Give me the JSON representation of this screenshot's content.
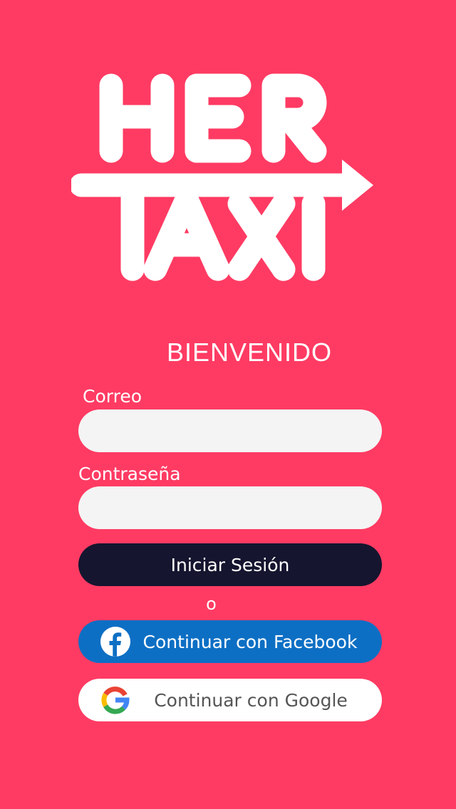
{
  "brand": {
    "logo_line1": "HER",
    "logo_line2": "TAXI"
  },
  "welcome": "BIENVENIDO",
  "form": {
    "email_label": "Correo",
    "email_value": "",
    "password_label": "Contraseña",
    "password_value": ""
  },
  "buttons": {
    "login": "Iniciar Sesión",
    "separator": "o",
    "facebook": "Continuar con Facebook",
    "google": "Continuar con Google"
  },
  "colors": {
    "background": "#ff3b63",
    "login_button": "#15152f",
    "facebook_button": "#0d6fc4",
    "google_button": "#ffffff",
    "field_background": "#f4f4f4"
  },
  "icons": {
    "facebook": "facebook-logo-icon",
    "google": "google-logo-icon"
  }
}
